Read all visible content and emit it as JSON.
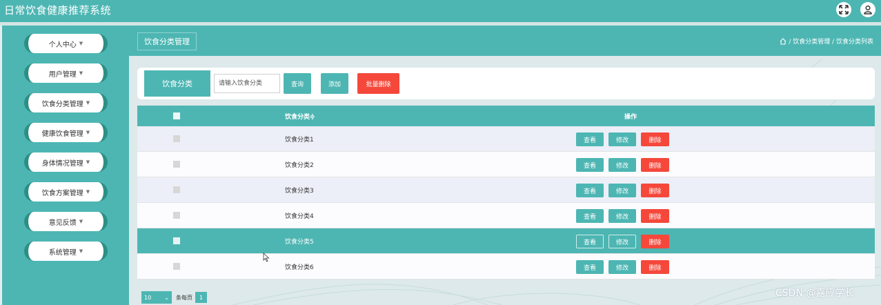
{
  "app": {
    "title": "日常饮食健康推荐系统"
  },
  "header_icons": [
    "fullscreen-icon",
    "user-icon"
  ],
  "sidebar": {
    "items": [
      {
        "label": "个人中心"
      },
      {
        "label": "用户管理"
      },
      {
        "label": "饮食分类管理"
      },
      {
        "label": "健康饮食管理"
      },
      {
        "label": "身体情况管理"
      },
      {
        "label": "饮食方案管理"
      },
      {
        "label": "意见反馈"
      },
      {
        "label": "系统管理"
      }
    ],
    "caret": "▼"
  },
  "page": {
    "title": "饮食分类管理",
    "breadcrumb": "/ 饮食分类管理 / 饮食分类列表"
  },
  "search": {
    "label": "饮食分类",
    "placeholder": "请输入饮食分类",
    "query_label": "查询",
    "add_label": "添加",
    "batch_delete_label": "批量删除"
  },
  "table": {
    "columns": [
      "饮食分类≑",
      "操作"
    ],
    "rows": [
      {
        "name": "饮食分类1"
      },
      {
        "name": "饮食分类2"
      },
      {
        "name": "饮食分类3"
      },
      {
        "name": "饮食分类4"
      },
      {
        "name": "饮食分类5"
      },
      {
        "name": "饮食分类6"
      }
    ],
    "actions": {
      "view": "查看",
      "edit": "修改",
      "delete": "删除"
    },
    "selected_row": "饮食分类5"
  },
  "pagination": {
    "page_size": "10",
    "per_page_label": "条每页",
    "current_page": "1"
  },
  "watermark": "CSDN @嘉应学长",
  "colors": {
    "primary": "#4db6b3",
    "danger": "#f5483b",
    "sidebar_accent": "#2c8f84"
  }
}
